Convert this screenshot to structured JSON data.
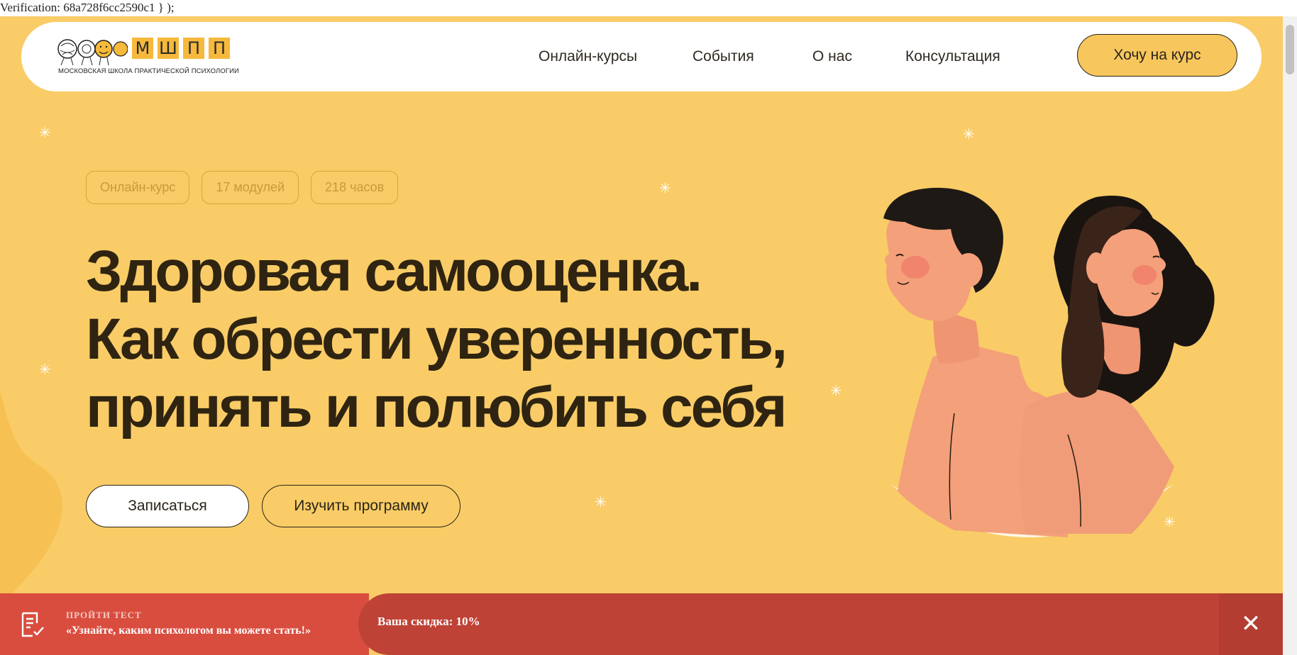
{
  "verification": "Verification: 68a728f6cc2590c1 } );",
  "header": {
    "logo": {
      "letters": [
        "М",
        "Ш",
        "П",
        "П"
      ],
      "tagline": "Московская школа практической психологии"
    },
    "nav": [
      "Онлайн-курсы",
      "События",
      "О нас",
      "Консультация"
    ],
    "cta": "Хочу на курс"
  },
  "hero": {
    "tags": [
      "Онлайн-курс",
      "17 модулей",
      "218 часов"
    ],
    "title_lines": [
      "Здоровая самооценка.",
      "Как обрести уверенность,",
      "принять и полюбить себя"
    ],
    "primary_button": "Записаться",
    "secondary_button": "Изучить программу"
  },
  "promo": {
    "kicker": "ПРОЙТИ ТЕСТ",
    "text": "«Узнайте, каким психологом вы можете стать!»",
    "discount": "Ваша скидка: 10%",
    "close": "✕"
  },
  "colors": {
    "background": "#f9cc67",
    "title": "#2f2411",
    "promo_red": "#d94d3f",
    "promo_dark": "#bf4236"
  },
  "icons": [
    "test-checklist-icon",
    "close-icon",
    "sparkle-icon"
  ]
}
